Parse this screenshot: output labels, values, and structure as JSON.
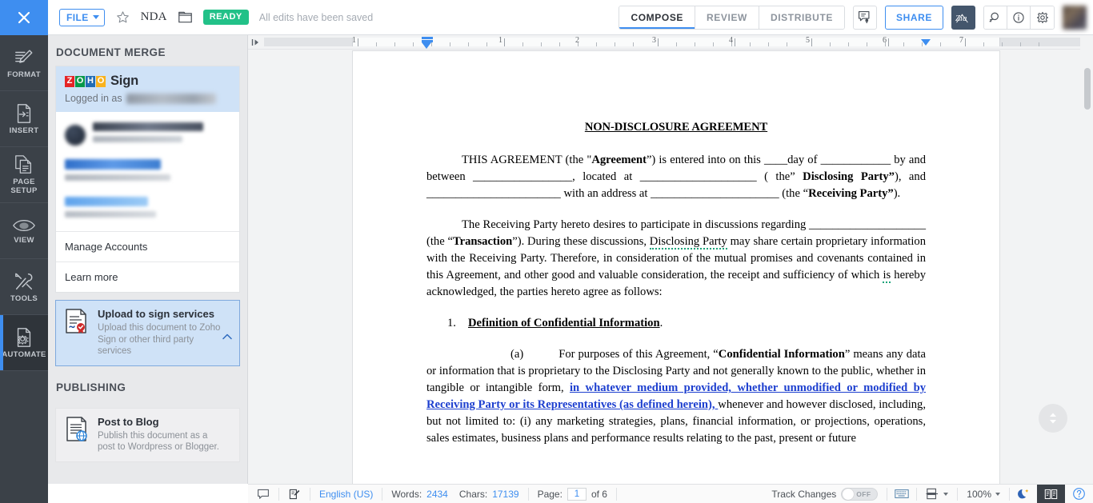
{
  "topbar": {
    "close_icon": "close-icon",
    "file_label": "FILE",
    "star_icon": "star-icon",
    "doc_title": "NDA",
    "folder_icon": "folder-icon",
    "status_badge": "READY",
    "saved_text": "All edits have been saved",
    "modes": [
      {
        "label": "COMPOSE",
        "active": true
      },
      {
        "label": "REVIEW",
        "active": false
      },
      {
        "label": "DISTRIBUTE",
        "active": false
      }
    ],
    "notify_icon": "comment-notification-icon",
    "share_label": "SHARE",
    "zia_label": "Zia",
    "search_icon": "search-icon",
    "info_icon": "info-icon",
    "settings_icon": "gear-icon",
    "avatar": "user-avatar"
  },
  "rail": {
    "items": [
      {
        "label": "FORMAT",
        "icon": "format-brush-icon",
        "active": false
      },
      {
        "label": "INSERT",
        "icon": "insert-document-icon",
        "active": false
      },
      {
        "label": "PAGE\nSETUP",
        "label_l1": "PAGE",
        "label_l2": "SETUP",
        "icon": "page-setup-icon",
        "active": false
      },
      {
        "label": "VIEW",
        "icon": "eye-icon",
        "active": false
      },
      {
        "label": "TOOLS",
        "icon": "tools-wrench-icon",
        "active": false
      },
      {
        "label": "AUTOMATE",
        "icon": "automate-gear-document-icon",
        "active": true
      }
    ]
  },
  "panel": {
    "section_title": "DOCUMENT MERGE",
    "account": {
      "brand_zoho": "ZOHO",
      "brand_letters": [
        "Z",
        "O",
        "H",
        "O"
      ],
      "brand_colors": [
        "#e42527",
        "#089949",
        "#226db4",
        "#f9b21d"
      ],
      "product": "Sign",
      "logged_in_label": "Logged in as",
      "logged_in_value": ""
    },
    "links": [
      {
        "label": "Manage Accounts"
      },
      {
        "label": "Learn more"
      }
    ],
    "upload_card": {
      "title": "Upload to sign services",
      "subtitle": "Upload this document to Zoho Sign or other third party services",
      "icon": "signed-document-icon",
      "chevron": "chevron-up-icon"
    },
    "publishing_title": "PUBLISHING",
    "publish_card": {
      "title": "Post to Blog",
      "subtitle": "Publish this document as a post to Wordpress or Blogger.",
      "icon": "blog-document-icon"
    }
  },
  "ruler": {
    "numbers": [
      "1",
      "1",
      "2",
      "3",
      "4",
      "5",
      "6",
      "7"
    ],
    "left_indent_marker": "left-indent-marker",
    "right_indent_marker": "right-indent-marker"
  },
  "document": {
    "title": "NON-DISCLOSURE AGREEMENT",
    "p1_a": "THIS AGREEMENT (the \"",
    "p1_b": "Agreement",
    "p1_c": "”) is entered into on this ____day of ____________ by and between _________________, located at ____________________ ( the” ",
    "p1_d": "Disclosing Party”",
    "p1_e": "), and _______________________ with an address at ______________________ (the “",
    "p1_f": "Receiving Party”",
    "p1_g": ").",
    "p2_a": "The Receiving Party hereto desires to participate in discussions regarding ____________________ (the “",
    "p2_b": "Transaction",
    "p2_c": "”).  During these discussions, ",
    "p2_squiggle": "Disclosing Party",
    "p2_d": " may share certain proprietary information with the Receiving Party.  Therefore, in consideration of the mutual promises and covenants contained in this Agreement, and other good and valuable consideration, the receipt and sufficiency of which ",
    "p2_squiggle2": "is",
    "p2_e": " hereby acknowledged, the parties hereto agree as follows:",
    "item1_num": "1.",
    "item1_text": "Definition of Confidential Information",
    "item1_period": ".",
    "p3_label": "(a)",
    "p3_a": "For purposes of this Agreement, “",
    "p3_b": "Confidential Information",
    "p3_c": "” means any data or information that is proprietary to the Disclosing Party and not generally known to the public, whether in tangible or intangible form, ",
    "p3_link": "in whatever medium provided, whether unmodified or modified by Receiving Party or its Representatives (as defined herein), ",
    "p3_d": "whenever and however disclosed, including, but not limited to: (i) any marketing strategies, plans, financial information, or projections, operations, sales estimates, business plans and performance results relating to the past, present or future"
  },
  "statusbar": {
    "comment_icon": "comment-icon",
    "edit_icon": "edit-note-icon",
    "language": "English (US)",
    "words_label": "Words:",
    "words_value": "2434",
    "chars_label": "Chars:",
    "chars_value": "17139",
    "page_label": "Page:",
    "page_current": "1",
    "page_total": "of 6",
    "track_changes_label": "Track Changes",
    "track_changes_state": "OFF",
    "keyboard_icon": "keyboard-icon",
    "layout_icon": "page-layout-icon",
    "zoom_level": "100%",
    "dark_mode_icon": "moon-icon",
    "reader_icon": "reading-mode-icon",
    "help_icon": "help-icon"
  },
  "nav_circle_icon": "scroll-up-down-icon"
}
